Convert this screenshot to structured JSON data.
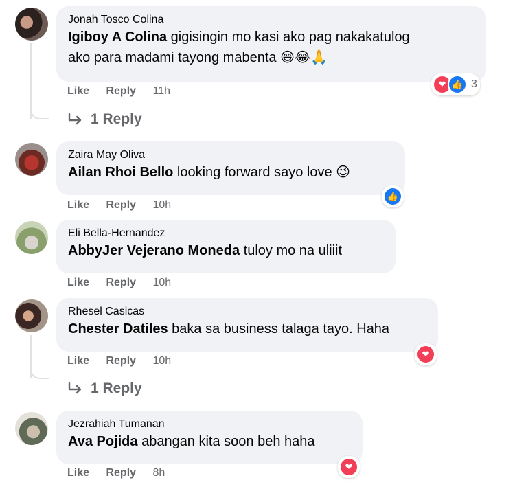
{
  "comments": [
    {
      "author": "Jonah Tosco Colina",
      "mention": "Igiboy A Colina",
      "text_line1": " gigisingin mo kasi ako pag nakakatulog",
      "text_line2": "ako para madami tayong mabenta 😄😂🙏",
      "like": "Like",
      "reply": "Reply",
      "time": "11h",
      "reaction_count": "3",
      "replies_label": "1 Reply"
    },
    {
      "author": "Zaira May Oliva",
      "mention": "Ailan Rhoi Bello",
      "text": " looking forward sayo love 😉",
      "like": "Like",
      "reply": "Reply",
      "time": "10h"
    },
    {
      "author": "Eli Bella-Hernandez",
      "mention": "AbbyJer Vejerano Moneda",
      "text": " tuloy mo na uliiit",
      "like": "Like",
      "reply": "Reply",
      "time": "10h"
    },
    {
      "author": "Rhesel Casicas",
      "mention": "Chester Datiles",
      "text": " baka sa business talaga tayo. Haha",
      "like": "Like",
      "reply": "Reply",
      "time": "10h",
      "replies_label": "1 Reply"
    },
    {
      "author": "Jezrahiah Tumanan",
      "mention": "Ava Pojida",
      "text": " abangan kita soon beh haha",
      "like": "Like",
      "reply": "Reply",
      "time": "8h"
    }
  ]
}
